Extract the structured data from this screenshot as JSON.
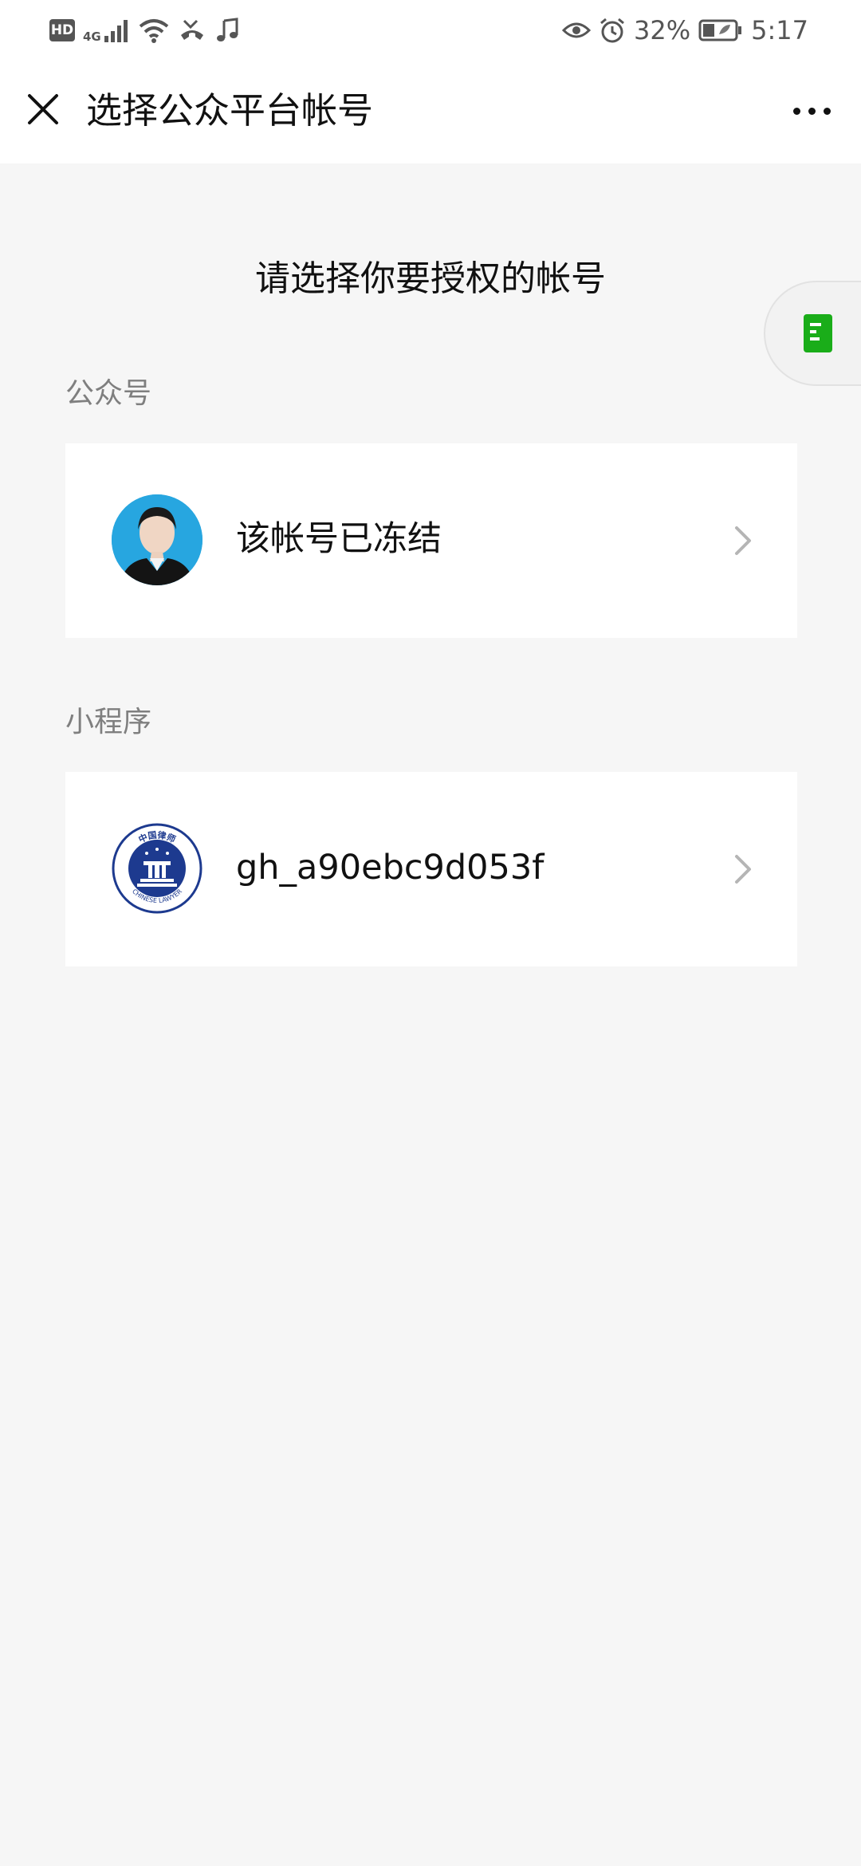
{
  "status_bar": {
    "hd": "HD",
    "network": "4G",
    "battery_percent": "32%",
    "time": "5:17"
  },
  "header": {
    "title": "选择公众平台帐号"
  },
  "prompt": "请选择你要授权的帐号",
  "sections": [
    {
      "label": "公众号",
      "account_name": "该帐号已冻结",
      "icon": "user-photo-avatar"
    },
    {
      "label": "小程序",
      "account_name": "gh_a90ebc9d053f",
      "icon": "chinese-lawyer-logo"
    }
  ],
  "logo_text": {
    "top": "中国律师",
    "bottom": "CHINESE LAWYER"
  },
  "colors": {
    "floating_tab_icon": "#1aad19",
    "avatar_bg": "#27a6e0",
    "logo_blue": "#1d3a8f"
  }
}
